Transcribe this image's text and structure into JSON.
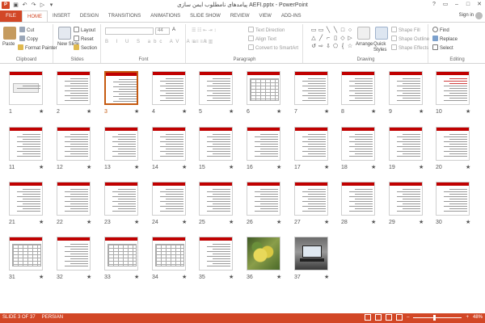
{
  "window": {
    "title": "پیامدهای نامطلوب ایمن سازی AEFI.pptx - PowerPoint",
    "app_icon": "P",
    "controls": [
      "?",
      "▭",
      "–",
      "□",
      "✕"
    ]
  },
  "tabs": {
    "file": "FILE",
    "items": [
      "HOME",
      "INSERT",
      "DESIGN",
      "TRANSITIONS",
      "ANIMATIONS",
      "SLIDE SHOW",
      "REVIEW",
      "VIEW",
      "ADD-INS"
    ],
    "active": "HOME",
    "signin": "Sign in"
  },
  "ribbon": {
    "clipboard": {
      "label": "Clipboard",
      "paste": "Paste",
      "cut": "Cut",
      "copy": "Copy",
      "format_painter": "Format Painter"
    },
    "slides": {
      "label": "Slides",
      "new_slide": "New Slide",
      "layout": "Layout",
      "reset": "Reset",
      "section": "Section"
    },
    "font": {
      "label": "Font",
      "size": "44",
      "buttons": [
        "B",
        "I",
        "U",
        "S",
        "abc",
        "AV",
        "Aa",
        "A"
      ]
    },
    "paragraph": {
      "label": "Paragraph",
      "text_direction": "Text Direction",
      "align_text": "Align Text",
      "smartart": "Convert to SmartArt"
    },
    "drawing": {
      "label": "Drawing",
      "arrange": "Arrange",
      "quick_styles": "Quick Styles",
      "shape_fill": "Shape Fill",
      "shape_outline": "Shape Outline",
      "shape_effects": "Shape Effects",
      "shapes": [
        "▭",
        "▭",
        "╲",
        "╲",
        "□",
        "○",
        "△",
        "╱",
        "⌐",
        "▯",
        "◇",
        "▷",
        "↺",
        "⇨",
        "⇩",
        "⬠",
        "{",
        "☆"
      ]
    },
    "editing": {
      "label": "Editing",
      "find": "Find",
      "replace": "Replace",
      "select": "Select"
    }
  },
  "slides": [
    {
      "num": "1",
      "kind": "title"
    },
    {
      "num": "2",
      "kind": "text"
    },
    {
      "num": "3",
      "kind": "text",
      "selected": true
    },
    {
      "num": "4",
      "kind": "text"
    },
    {
      "num": "5",
      "kind": "text"
    },
    {
      "num": "6",
      "kind": "table"
    },
    {
      "num": "7",
      "kind": "text"
    },
    {
      "num": "8",
      "kind": "text"
    },
    {
      "num": "9",
      "kind": "text"
    },
    {
      "num": "10",
      "kind": "redtext"
    },
    {
      "num": "11",
      "kind": "text"
    },
    {
      "num": "12",
      "kind": "text"
    },
    {
      "num": "13",
      "kind": "text"
    },
    {
      "num": "14",
      "kind": "text"
    },
    {
      "num": "15",
      "kind": "text"
    },
    {
      "num": "16",
      "kind": "text"
    },
    {
      "num": "17",
      "kind": "text"
    },
    {
      "num": "18",
      "kind": "text"
    },
    {
      "num": "19",
      "kind": "text"
    },
    {
      "num": "20",
      "kind": "text"
    },
    {
      "num": "21",
      "kind": "text"
    },
    {
      "num": "22",
      "kind": "text"
    },
    {
      "num": "23",
      "kind": "text"
    },
    {
      "num": "24",
      "kind": "text"
    },
    {
      "num": "25",
      "kind": "text"
    },
    {
      "num": "26",
      "kind": "text"
    },
    {
      "num": "27",
      "kind": "text"
    },
    {
      "num": "28",
      "kind": "text"
    },
    {
      "num": "29",
      "kind": "text"
    },
    {
      "num": "30",
      "kind": "text"
    },
    {
      "num": "31",
      "kind": "table"
    },
    {
      "num": "32",
      "kind": "text"
    },
    {
      "num": "33",
      "kind": "table"
    },
    {
      "num": "34",
      "kind": "table"
    },
    {
      "num": "35",
      "kind": "text"
    },
    {
      "num": "36",
      "kind": "photo-food"
    },
    {
      "num": "37",
      "kind": "photo-laptop"
    }
  ],
  "star": "★",
  "status": {
    "slide": "SLIDE 3 OF 37",
    "language": "PERSIAN",
    "zoom": "48%"
  }
}
